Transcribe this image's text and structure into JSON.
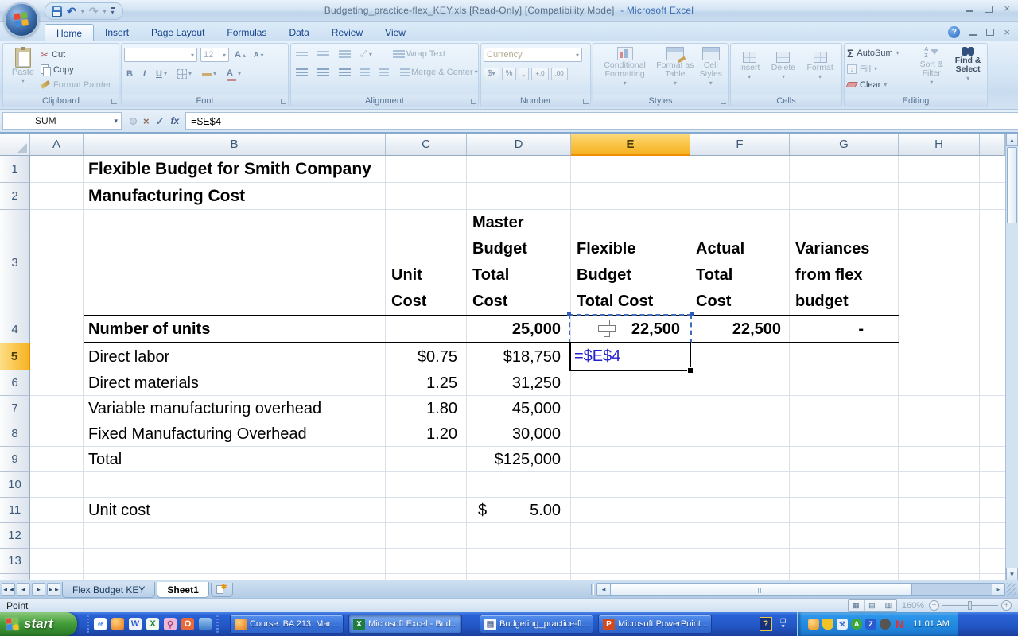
{
  "titlebar": {
    "file": "Budgeting_practice-flex_KEY.xls  [Read-Only]  [Compatibility Mode]",
    "app": "- Microsoft Excel"
  },
  "tabs": [
    "Home",
    "Insert",
    "Page Layout",
    "Formulas",
    "Data",
    "Review",
    "View"
  ],
  "ribbon": {
    "clipboard": {
      "group": "Clipboard",
      "paste": "Paste",
      "cut": "Cut",
      "copy": "Copy",
      "format_painter": "Format Painter"
    },
    "font": {
      "group": "Font",
      "size": "12",
      "bold": "B",
      "italic": "I",
      "underline": "U",
      "grow": "A",
      "shrink": "A",
      "color": "A"
    },
    "alignment": {
      "group": "Alignment",
      "wrap_text": "Wrap Text",
      "merge_center": "Merge & Center"
    },
    "number": {
      "group": "Number",
      "format": "Currency",
      "currency": "$",
      "percent": "%",
      "comma": ",",
      "inc_dec": "+.0",
      "dec_dec": ".00"
    },
    "styles": {
      "group": "Styles",
      "conditional": "Conditional Formatting",
      "format_table": "Format as Table",
      "cell_styles": "Cell Styles"
    },
    "cells": {
      "group": "Cells",
      "insert": "Insert",
      "delete": "Delete",
      "format": "Format"
    },
    "editing": {
      "group": "Editing",
      "sigma": "Σ",
      "autosum": "AutoSum",
      "fill": "Fill",
      "clear": "Clear",
      "sort_filter": "Sort & Filter",
      "find_select": "Find & Select"
    }
  },
  "formula_bar": {
    "name_box": "SUM",
    "fx": "fx",
    "formula": "=$E$4"
  },
  "grid": {
    "columns": [
      "A",
      "B",
      "C",
      "D",
      "E",
      "F",
      "G",
      "H"
    ],
    "rows": [
      "1",
      "2",
      "3",
      "4",
      "5",
      "6",
      "7",
      "8",
      "9",
      "10",
      "11",
      "12",
      "13"
    ],
    "selected_column": "E",
    "selected_row": "5"
  },
  "cells": {
    "b1": "Flexible Budget for Smith Company",
    "b2": "Manufacturing Cost",
    "c3": [
      "Unit",
      "Cost"
    ],
    "d3": [
      "Master",
      "Budget",
      "Total",
      "Cost"
    ],
    "e3": [
      "Flexible",
      "Budget",
      "Total Cost"
    ],
    "f3": [
      "Actual",
      "Total",
      "Cost"
    ],
    "g3": [
      "Variances",
      "from flex",
      "budget"
    ],
    "b4": "Number of units",
    "d4": "25,000",
    "e4": "22,500",
    "f4": "22,500",
    "g4": "-",
    "b5": "Direct labor",
    "c5": "$0.75",
    "d5": "$18,750",
    "e5": "=$E$4",
    "b6": "Direct materials",
    "c6": "1.25",
    "d6": "31,250",
    "b7": "Variable manufacturing overhead",
    "c7": "1.80",
    "d7": "45,000",
    "b8": "Fixed Manufacturing Overhead",
    "c8": "1.20",
    "d8": "30,000",
    "b9": "Total",
    "d9": "$125,000",
    "b11": "Unit cost",
    "d11_symbol": "$",
    "d11_value": "5.00"
  },
  "sheet_tabs": {
    "tab1": "Flex Budget KEY",
    "tab2": "Sheet1"
  },
  "status_bar": {
    "mode": "Point",
    "zoom_level": "160%"
  },
  "taskbar": {
    "start_label": "start",
    "quick_launch_icons": [
      "ie-icon",
      "firefox-icon",
      "word-icon",
      "excel-icon",
      "key-icon",
      "outlook-icon",
      "messenger-icon"
    ],
    "tasks": [
      {
        "icon": "firefox-icon",
        "label": "Course: BA 213: Man..."
      },
      {
        "icon": "excel-icon",
        "label": "Microsoft Excel - Bud..."
      },
      {
        "icon": "document-icon",
        "label": "Budgeting_practice-fl..."
      },
      {
        "icon": "powerpoint-icon",
        "label": "Microsoft PowerPoint ..."
      }
    ],
    "tray_icons": [
      "update-icon",
      "shield-icon",
      "tools-icon",
      "antivirus-icon",
      "z-icon",
      "volume-icon",
      "netscape-icon"
    ],
    "clock": "11:01 AM"
  },
  "colors": {
    "selected_header": "#f6b222",
    "formula_text": "#2222cc",
    "taskbar_blue": "#2356c4",
    "start_green": "#2f8229"
  }
}
